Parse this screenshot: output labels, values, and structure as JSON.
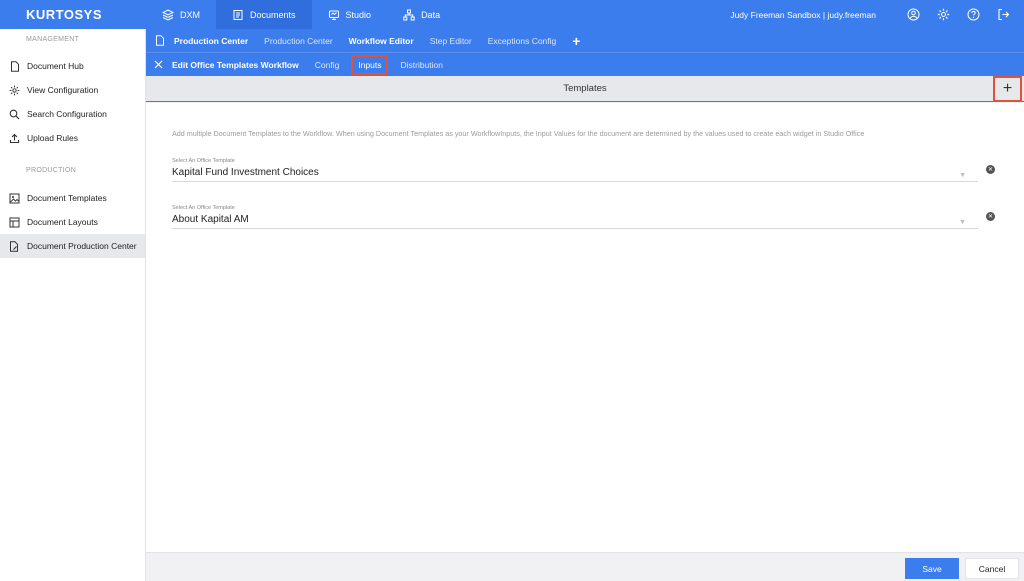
{
  "app": {
    "logo": "KURTOSYS"
  },
  "topnav": {
    "items": [
      {
        "label": "DXM",
        "icon": "layers-icon"
      },
      {
        "label": "Documents",
        "icon": "documents-icon"
      },
      {
        "label": "Studio",
        "icon": "studio-icon"
      },
      {
        "label": "Data",
        "icon": "data-icon"
      }
    ],
    "active": "Documents",
    "user": "Judy Freeman Sandbox  |  judy.freeman"
  },
  "sidebar": {
    "management_label": "MANAGEMENT",
    "production_label": "PRODUCTION",
    "management_items": [
      {
        "label": "Document Hub"
      },
      {
        "label": "View Configuration"
      },
      {
        "label": "Search Configuration"
      },
      {
        "label": "Upload Rules"
      }
    ],
    "production_items": [
      {
        "label": "Document Templates"
      },
      {
        "label": "Document Layouts"
      },
      {
        "label": "Document Production Center"
      }
    ]
  },
  "tabs1": {
    "items": [
      "Production Center",
      "Production Center",
      "Workflow Editor",
      "Step Editor",
      "Exceptions Config"
    ],
    "add": "+"
  },
  "tabs2": {
    "title": "Edit Office Templates Workflow",
    "items": [
      "Config",
      "Inputs",
      "Distribution"
    ],
    "active": "Inputs"
  },
  "section": {
    "title": "Templates",
    "add": "+"
  },
  "help_text": "Add multiple Document Templates to the Workflow. When using Document Templates as your WorkflowInputs, the Input Values for the document are determined by the values used to create each widget in Studio Office",
  "templates": [
    {
      "label": "Select An Office Template",
      "value": "Kapital Fund Investment Choices"
    },
    {
      "label": "Select An Office Template",
      "value": "About Kapital AM"
    }
  ],
  "footer": {
    "save": "Save",
    "cancel": "Cancel"
  },
  "colors": {
    "primary": "#3b7ded",
    "highlight": "#e0533a"
  }
}
